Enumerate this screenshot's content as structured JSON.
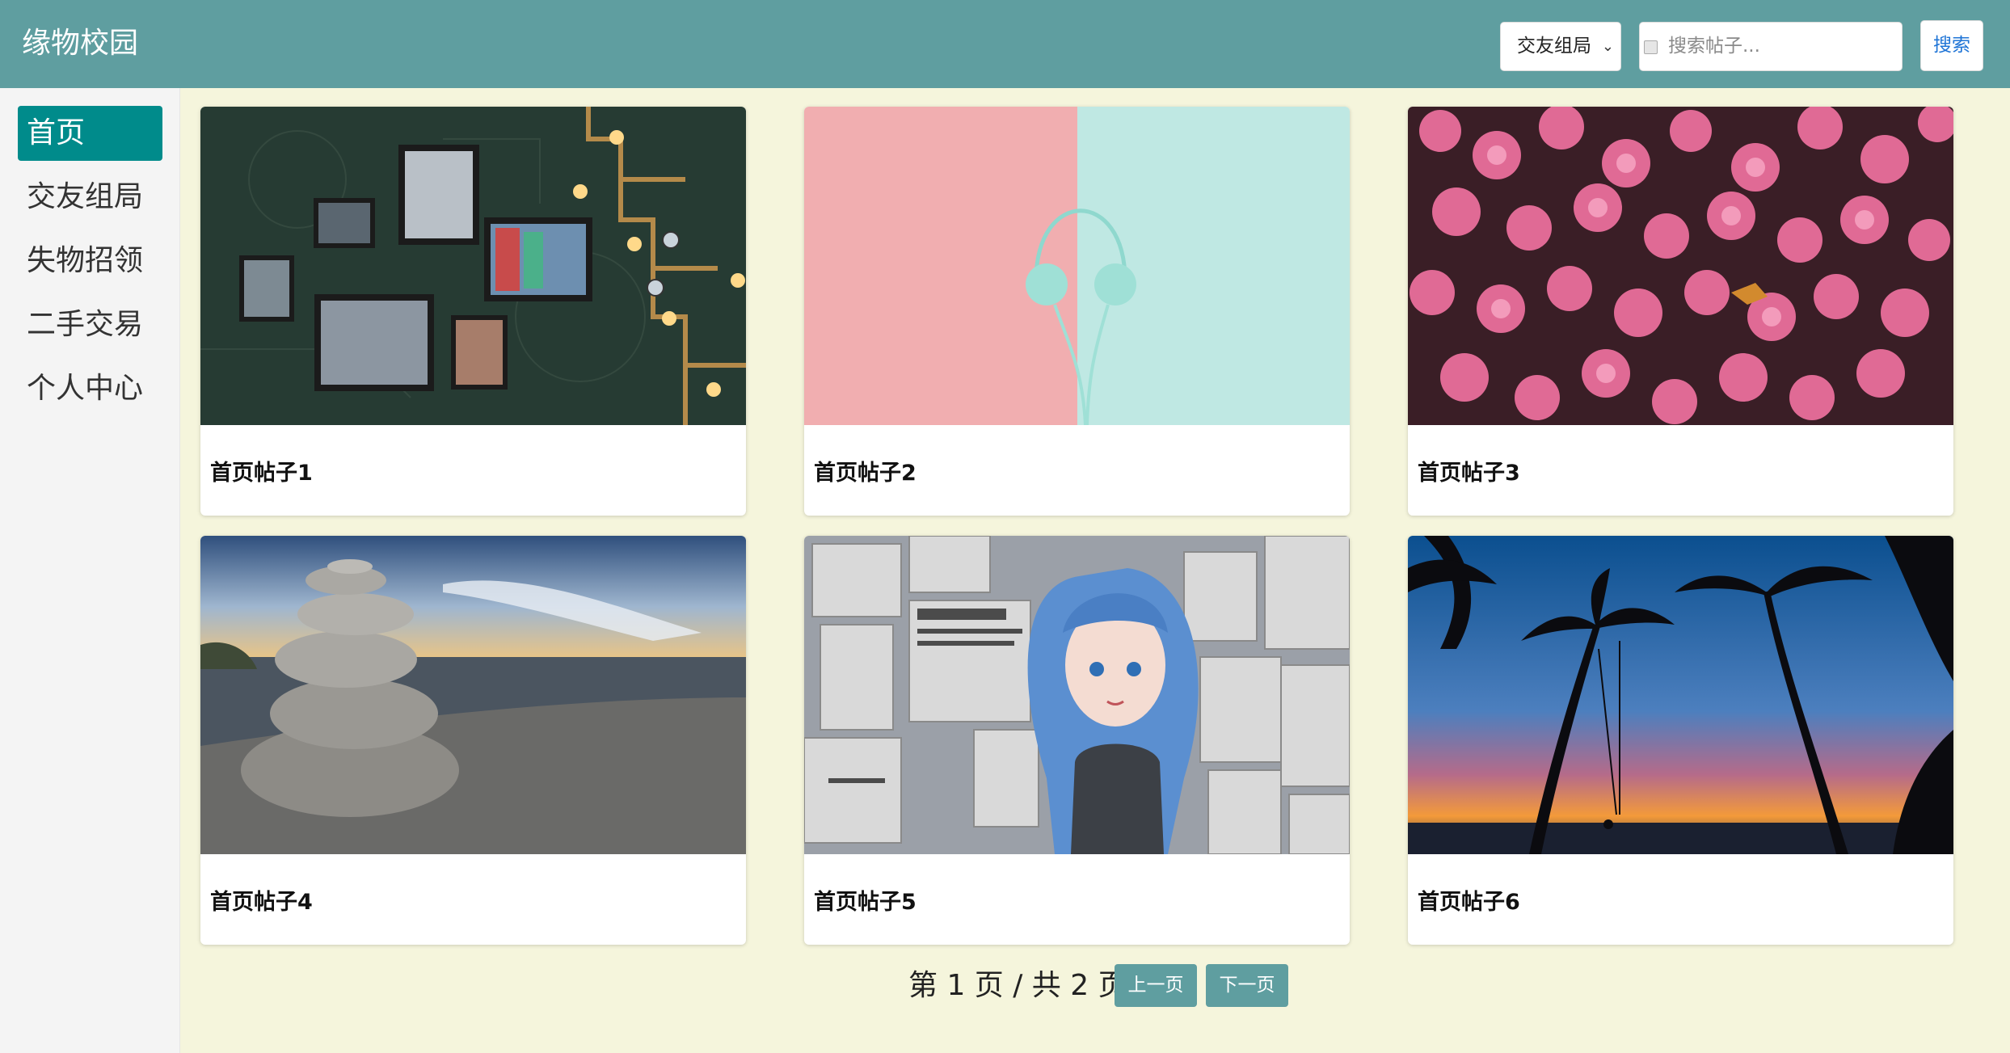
{
  "header": {
    "brand": "缘物校园",
    "category_select": {
      "selected": "交友组局"
    },
    "search": {
      "placeholder": "搜索帖子...",
      "button_label": "搜索"
    }
  },
  "sidebar": {
    "items": [
      {
        "label": "首页",
        "active": true
      },
      {
        "label": "交友组局"
      },
      {
        "label": "失物招领"
      },
      {
        "label": "二手交易"
      },
      {
        "label": "个人中心"
      }
    ]
  },
  "posts": [
    {
      "title": "首页帖子1",
      "image": "picture-frames-wall"
    },
    {
      "title": "首页帖子2",
      "image": "headphones-pastel"
    },
    {
      "title": "首页帖子3",
      "image": "pink-flowers"
    },
    {
      "title": "首页帖子4",
      "image": "stacked-stones-beach"
    },
    {
      "title": "首页帖子5",
      "image": "anime-girl-newspapers"
    },
    {
      "title": "首页帖子6",
      "image": "palm-trees-sunset"
    }
  ],
  "pagination": {
    "status_text": "第 1 页 / 共 2 页",
    "current_page": 1,
    "total_pages": 2,
    "prev_label": "上一页",
    "next_label": "下一页"
  },
  "colors": {
    "header_bg": "#5f9ea0",
    "sidebar_active": "#008b8b",
    "page_bg": "#f5f5dc",
    "pager_button": "#5f9ea0"
  }
}
